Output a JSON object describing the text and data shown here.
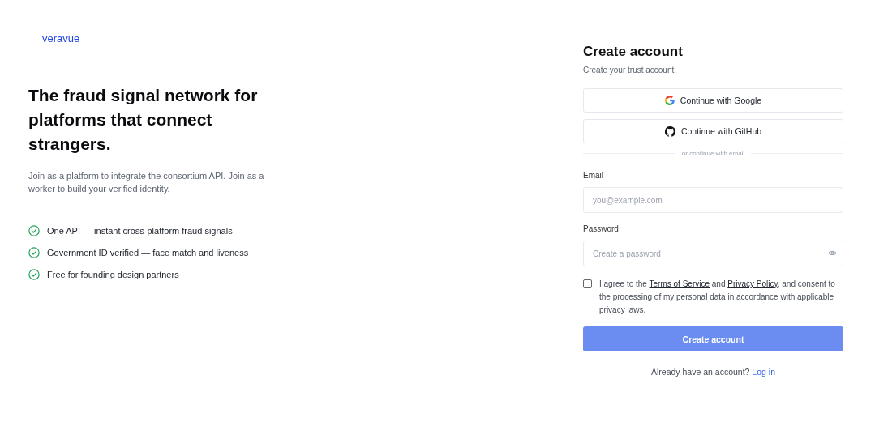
{
  "brand": {
    "name": "veravue"
  },
  "hero": {
    "headline": "The fraud signal network for platforms that connect strangers.",
    "description": "Join as a platform to integrate the consortium API. Join as a worker to build your verified identity.",
    "features": [
      {
        "text": "One API — instant cross-platform fraud signals"
      },
      {
        "text": "Government ID verified — face match and liveness"
      },
      {
        "text": "Free for founding design partners"
      }
    ]
  },
  "form": {
    "title": "Create account",
    "subtitle": "Create your trust account.",
    "providers": [
      {
        "kind": "google",
        "label": "Continue with Google"
      },
      {
        "kind": "github",
        "label": "Continue with GitHub"
      }
    ],
    "divider": "or continue with email",
    "fields": [
      {
        "kind": "email",
        "label": "Email",
        "placeholder": "you@example.com"
      },
      {
        "kind": "password",
        "label": "Password",
        "placeholder": "Create a password"
      }
    ],
    "consent": {
      "checked": false,
      "parts": [
        {
          "kind": "text",
          "text": "I agree to the "
        },
        {
          "kind": "link",
          "text": "Terms of Service"
        },
        {
          "kind": "text",
          "text": " and "
        },
        {
          "kind": "link",
          "text": "Privacy Policy"
        },
        {
          "kind": "text",
          "text": ", and consent to the processing of my personal data in accordance with applicable privacy laws."
        }
      ]
    },
    "submit": {
      "label": "Create account",
      "disabled": true
    },
    "footer": {
      "text": "Already have an account?",
      "link": "Log in"
    }
  }
}
